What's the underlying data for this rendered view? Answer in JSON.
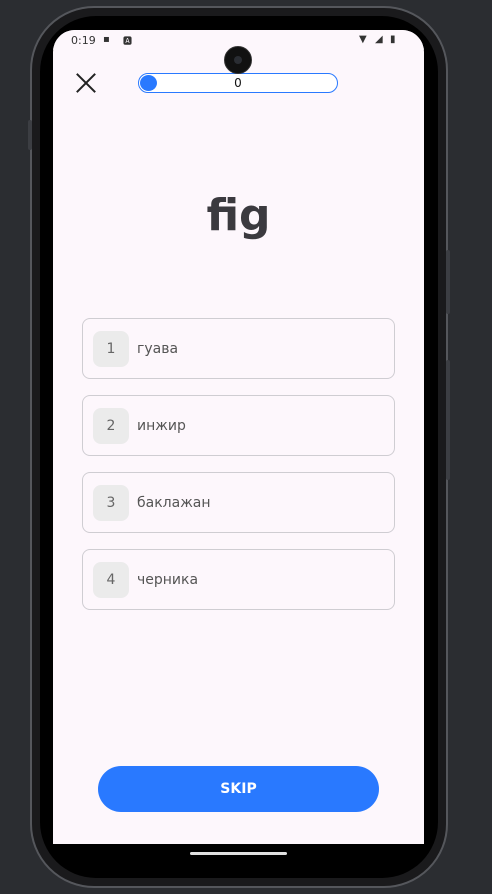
{
  "status_bar": {
    "time": "0:19",
    "icons": [
      "sim-card-icon",
      "keyboard-a-icon",
      "wifi-icon",
      "signal-icon",
      "battery-icon"
    ]
  },
  "quiz": {
    "progress_value": "0",
    "progress_fraction": 0.0,
    "word": "fig",
    "options": [
      {
        "number": "1",
        "label": "гуава"
      },
      {
        "number": "2",
        "label": "инжир"
      },
      {
        "number": "3",
        "label": "баклажан"
      },
      {
        "number": "4",
        "label": "черника"
      }
    ],
    "skip_label": "SKIP"
  },
  "colors": {
    "accent": "#2979ff",
    "background": "#fdf7fc",
    "word": "#3b3a3f"
  }
}
